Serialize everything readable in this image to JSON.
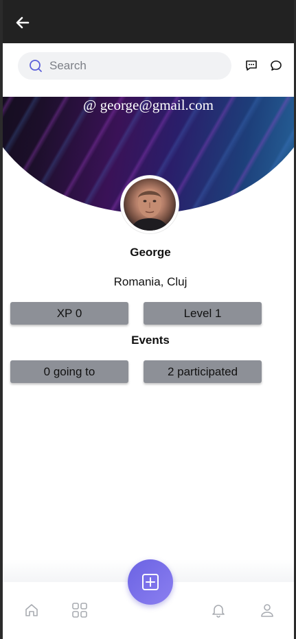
{
  "search": {
    "placeholder": "Search"
  },
  "header": {
    "icons": [
      "message-icon",
      "chat-bubble-icon"
    ]
  },
  "profile": {
    "email": "@ george@gmail.com",
    "name": "George",
    "location": "Romania, Cluj",
    "stats": {
      "xp": "XP 0",
      "level": "Level 1"
    },
    "events_title": "Events",
    "events": {
      "going": "0 going to",
      "participated": "2 participated"
    }
  },
  "bottom_nav": {
    "items": [
      "home-icon",
      "grid-icon",
      "add-icon",
      "bell-icon",
      "user-icon"
    ]
  },
  "colors": {
    "topbar": "#222222",
    "pill": "#8d9097",
    "fab_start": "#6b63e3",
    "fab_end": "#8b7ff0",
    "search_bg": "#f1f2f4"
  }
}
